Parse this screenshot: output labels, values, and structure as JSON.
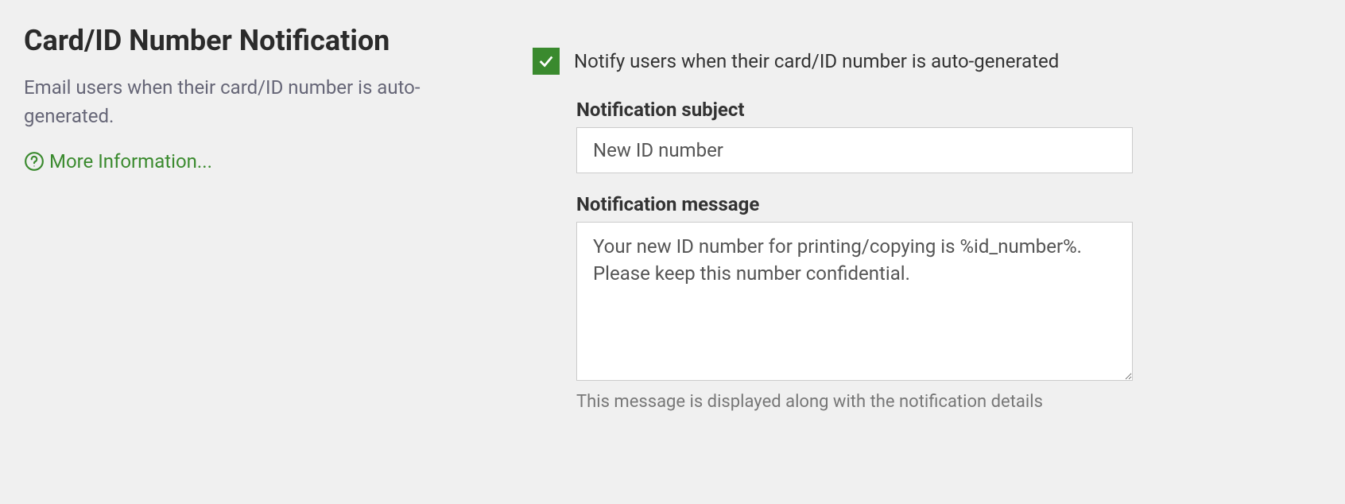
{
  "section": {
    "title": "Card/ID Number Notification",
    "description": "Email users when their card/ID number is auto-generated.",
    "more_info": "More Information..."
  },
  "form": {
    "notify_checkbox_label": "Notify users when their card/ID number is auto-generated",
    "notify_checked": true,
    "subject_label": "Notification subject",
    "subject_value": "New ID number",
    "message_label": "Notification message",
    "message_value": "Your new ID number for printing/copying is %id_number%. Please keep this number confidential.",
    "help_text": "This message is displayed along with the notification details"
  }
}
